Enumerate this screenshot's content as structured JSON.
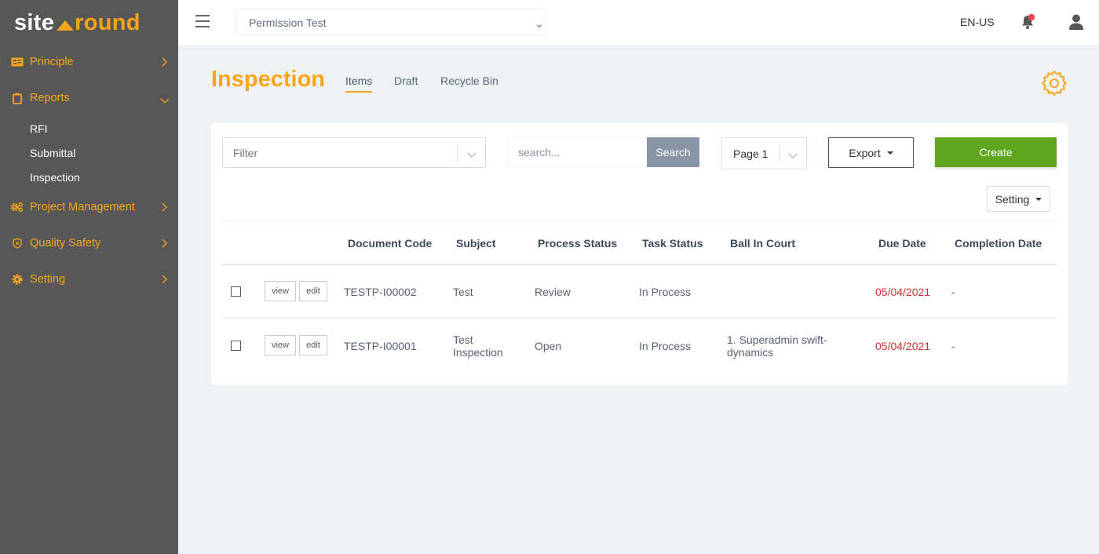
{
  "brand": {
    "part1": "site",
    "part2": "round",
    "accent": "#f9a51a"
  },
  "sidebar": {
    "items": [
      {
        "label": "Principle",
        "icon": "id-card-icon",
        "expanded": false
      },
      {
        "label": "Reports",
        "icon": "clipboard-icon",
        "expanded": true,
        "children": [
          {
            "label": "RFI"
          },
          {
            "label": "Submittal"
          },
          {
            "label": "Inspection"
          }
        ]
      },
      {
        "label": "Project Management",
        "icon": "cogs-icon",
        "expanded": false
      },
      {
        "label": "Quality Safety",
        "icon": "shield-icon",
        "expanded": false
      },
      {
        "label": "Setting",
        "icon": "gear-icon",
        "expanded": false
      }
    ]
  },
  "topbar": {
    "project": "Permission Test",
    "language": "EN-US",
    "notification_badge_color": "#e8474f"
  },
  "page": {
    "title": "Inspection",
    "tabs": [
      {
        "label": "Items",
        "active": true
      },
      {
        "label": "Draft"
      },
      {
        "label": "Recycle Bin"
      }
    ]
  },
  "toolbar": {
    "filter_placeholder": "Filter",
    "search_placeholder": "search...",
    "search_label": "Search",
    "page_value": "Page 1",
    "export_label": "Export",
    "create_label": "Create",
    "setting_label": "Setting",
    "create_color": "#5ea61d"
  },
  "table": {
    "columns": [
      "Document Code",
      "Subject",
      "Process Status",
      "Task Status",
      "Ball In Court",
      "Due Date",
      "Completion Date"
    ],
    "view_label": "view",
    "edit_label": "edit",
    "rows": [
      {
        "document_code": "TESTP-I00002",
        "subject": "Test",
        "process_status": "Review",
        "task_status": "In Process",
        "ball_in_court": "",
        "due_date": "05/04/2021",
        "completion_date": "-"
      },
      {
        "document_code": "TESTP-I00001",
        "subject": "Test Inspection",
        "process_status": "Open",
        "task_status": "In Process",
        "ball_in_court": "1. Superadmin swift-dynamics",
        "due_date": "05/04/2021",
        "completion_date": "-"
      }
    ]
  }
}
